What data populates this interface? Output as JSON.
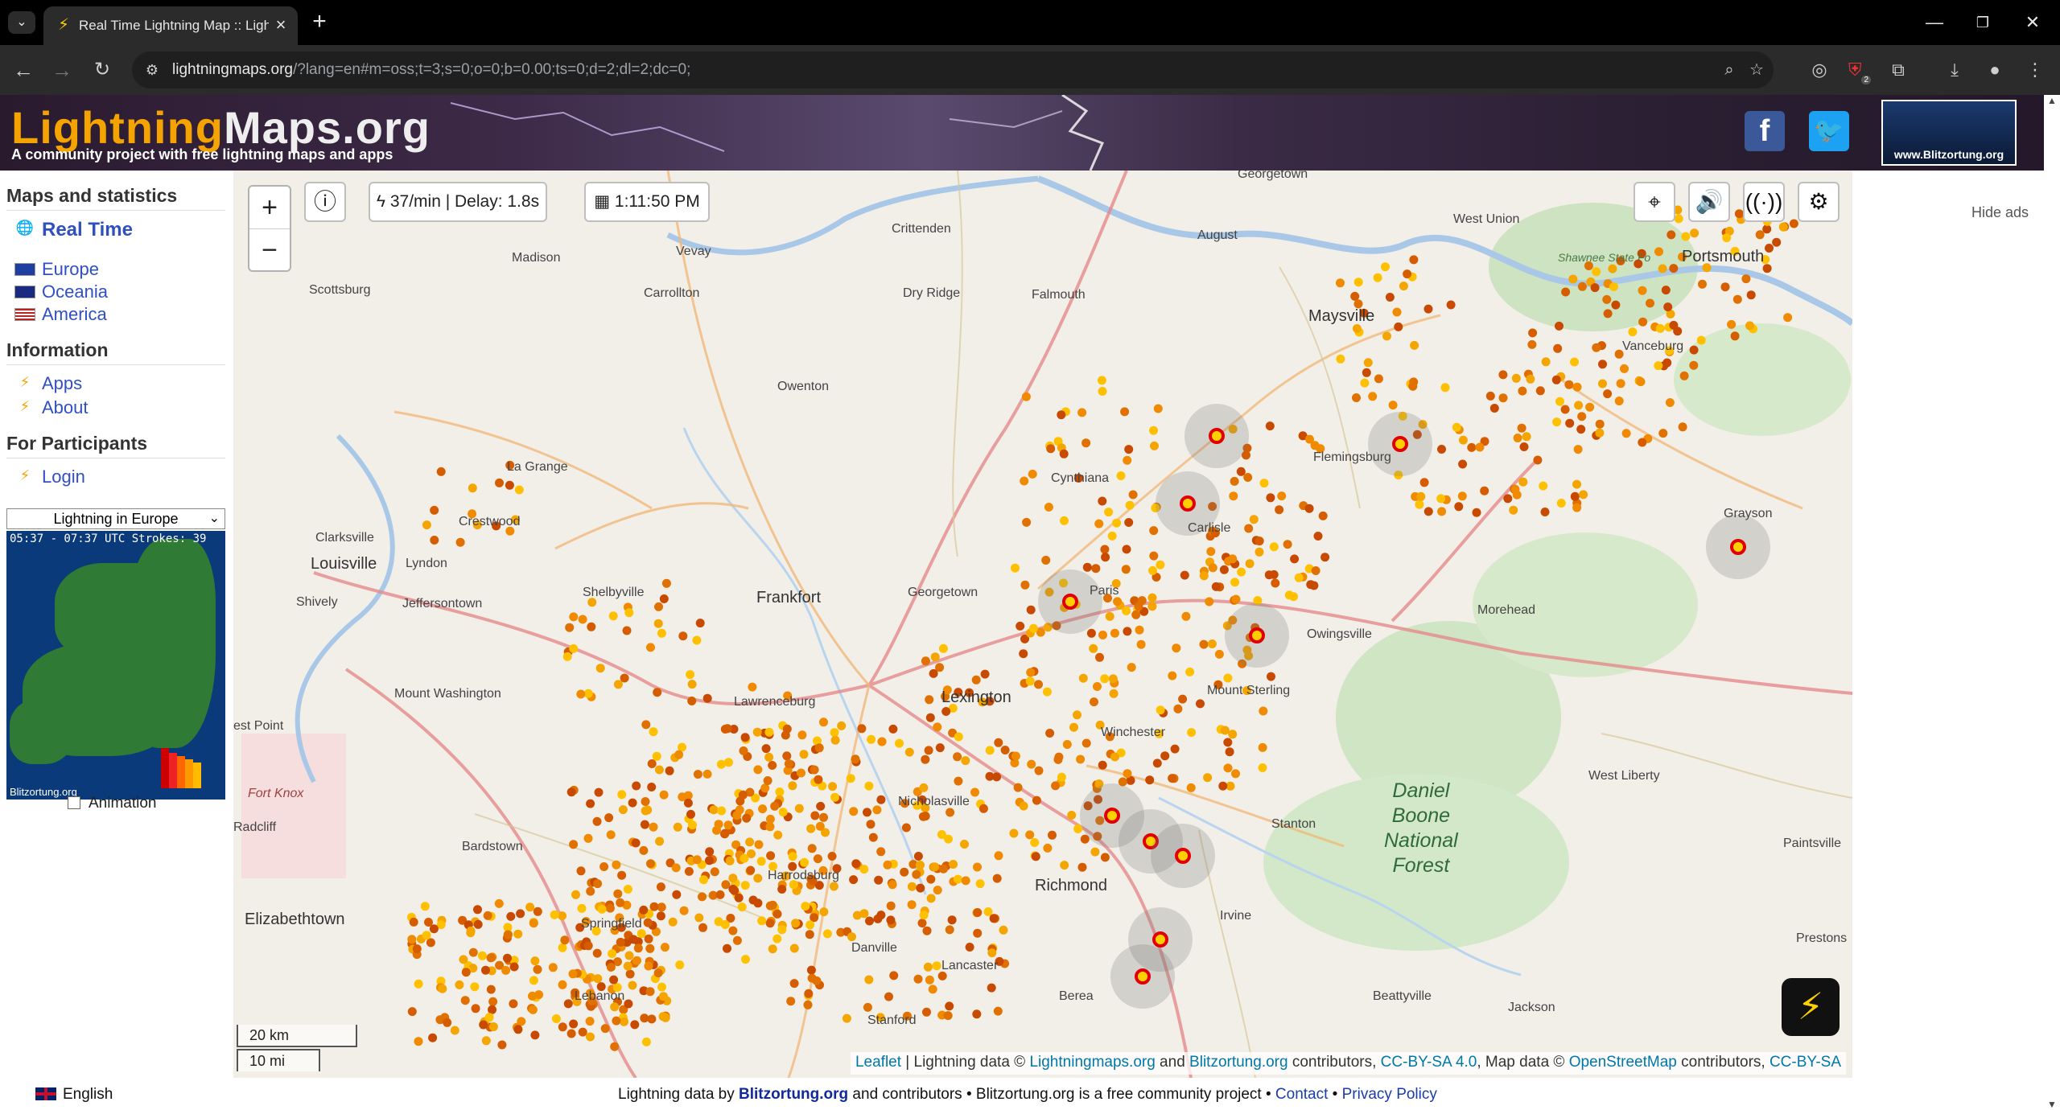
{
  "browser": {
    "tab_title": "Real Time Lightning Map :: Lightning",
    "url_host": "lightningmaps.org",
    "url_rest": "/?lang=en#m=oss;t=3;s=0;o=0;b=0.00;ts=0;d=2;dl=2;dc=0;",
    "extension_badge": "2"
  },
  "header": {
    "logo_part1": "Lightning",
    "logo_part2": "Maps.org",
    "tagline": "A community project with free lightning maps and apps",
    "facebook_label": "f",
    "blitz_label": "www.Blitzortung.org"
  },
  "sidebar": {
    "section_maps": "Maps and statistics",
    "realtime": "Real Time",
    "regions": [
      "Europe",
      "Oceania",
      "America"
    ],
    "section_info": "Information",
    "info_links": [
      "Apps",
      "About"
    ],
    "section_participants": "For Participants",
    "login": "Login",
    "region_select": "Lightning in Europe",
    "minimap_header": "05:37 - 07:37 UTC   Strokes: 39",
    "minimap_footer": "Blitzortung.org",
    "animation_label": "Animation"
  },
  "map": {
    "rate": "37/min | Delay: 1.8s",
    "time": "1:11:50 PM",
    "scale_km": "20 km",
    "scale_mi": "10 mi",
    "attribution": {
      "leaflet": "Leaflet",
      "t1": " | Lightning data © ",
      "lm": "Lightningmaps.org",
      "t2": " and ",
      "bo": "Blitzortung.org",
      "t3": " contributors, ",
      "cc": "CC-BY-SA 4.0",
      "t4": ", Map data © ",
      "osm": "OpenStreetMap",
      "t5": " contributors, ",
      "cc2": "CC-BY-SA"
    },
    "places": [
      "Georgetown",
      "West Union",
      "Portsmouth",
      "August",
      "Shawnee State Fo",
      "Madison",
      "Vevay",
      "Crittenden",
      "Dry Ridge",
      "Falmouth",
      "Maysville",
      "Vanceburg",
      "Scottsburg",
      "Carrollton",
      "Owenton",
      "Flemingsburg",
      "La Grange",
      "Cynthiana",
      "Grayson",
      "Clarksville",
      "Crestwood",
      "Louisville",
      "Lyndon",
      "Carlisle",
      "Shively",
      "Jeffersontown",
      "Shelbyville",
      "Frankfort",
      "Georgetown",
      "Paris",
      "Morehead",
      "Owingsville",
      "Mount Washington",
      "Lawrenceburg",
      "Lexington",
      "Mount Sterling",
      "est Point",
      "Winchester",
      "Fort Knox",
      "Nicholasville",
      "West Liberty",
      "Radcliff",
      "Bardstown",
      "Harrodsburg",
      "Stanton",
      "Paintsville",
      "Richmond",
      "Elizabethtown",
      "Springfield",
      "Danville",
      "Irvine",
      "Prestons",
      "Lancaster",
      "Lebanon",
      "Stanford",
      "Berea",
      "Beattyville",
      "Jackson"
    ],
    "forest": "Daniel\nBoone\nNational\nForest"
  },
  "right": {
    "hide_ads": "Hide ads"
  },
  "footer": {
    "language": "English",
    "t1": "Lightning data by ",
    "blitz": "Blitzortung.org",
    "t2": " and contributors • Blitzortung.org is a free community project • ",
    "contact": "Contact",
    "t3": " • ",
    "privacy": "Privacy Policy"
  }
}
